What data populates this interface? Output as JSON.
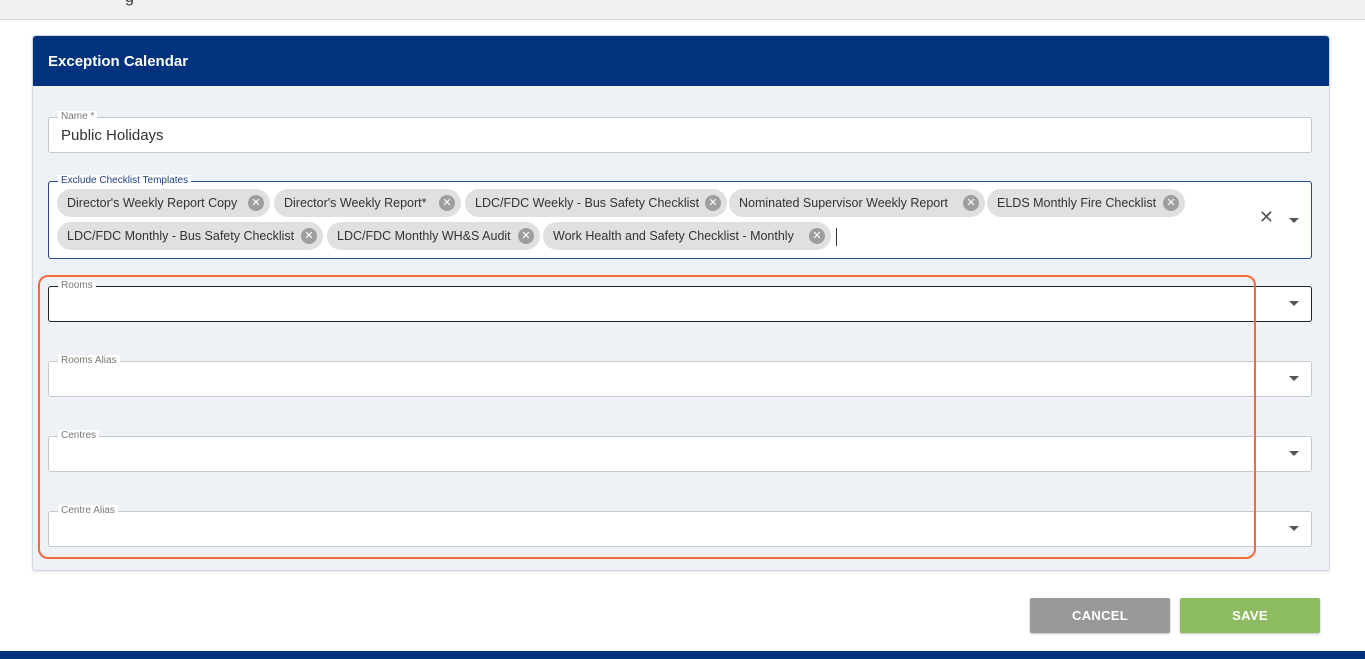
{
  "header": {
    "partial_title": "g"
  },
  "card": {
    "title": "Exception Calendar"
  },
  "name_field": {
    "label": "Name *",
    "value": "Public Holidays"
  },
  "templates_field": {
    "label": "Exclude Checklist Templates",
    "chips": [
      "Director's Weekly Report Copy",
      "Director's Weekly Report*",
      "LDC/FDC Weekly - Bus Safety Checklist",
      "Nominated Supervisor Weekly Report",
      "ELDS Monthly Fire Checklist",
      "LDC/FDC Monthly - Bus Safety Checklist",
      "LDC/FDC Monthly WH&S Audit",
      "Work Health and Safety Checklist - Monthly"
    ],
    "clear_icon": "close-icon",
    "chip_remove_icon": "cancel-circle-icon"
  },
  "rooms_field": {
    "label": "Rooms",
    "value": ""
  },
  "rooms_alias_field": {
    "label": "Rooms Alias",
    "value": ""
  },
  "centres_field": {
    "label": "Centres",
    "value": ""
  },
  "centre_alias_field": {
    "label": "Centre Alias",
    "value": ""
  },
  "actions": {
    "cancel_label": "CANCEL",
    "save_label": "SAVE"
  },
  "colors": {
    "header_bg": "#00327d",
    "highlight_border": "#ef6c3f",
    "save_bg": "#8dbb62",
    "cancel_bg": "#999999"
  }
}
